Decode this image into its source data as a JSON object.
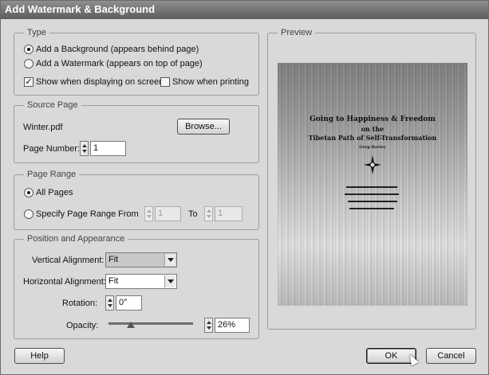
{
  "window": {
    "title": "Add Watermark & Background"
  },
  "type_group": {
    "legend": "Type",
    "option_background": "Add a Background (appears behind page)",
    "option_watermark": "Add a Watermark (appears on top of page)",
    "show_on_screen": "Show when displaying on screen",
    "show_when_printing": "Show when printing",
    "selected": "background",
    "show_on_screen_checked": true,
    "show_when_printing_checked": false
  },
  "source_group": {
    "legend": "Source Page",
    "file_name": "Winter.pdf",
    "browse_label": "Browse...",
    "page_number_label": "Page Number:",
    "page_number_value": "1"
  },
  "range_group": {
    "legend": "Page Range",
    "all_pages_label": "All Pages",
    "specify_label": "Specify Page Range",
    "from_label": "From",
    "from_value": "1",
    "to_label": "To",
    "to_value": "1",
    "selected": "all"
  },
  "position_group": {
    "legend": "Position and Appearance",
    "vertical_label": "Vertical Alignment:",
    "vertical_value": "Fit",
    "horizontal_label": "Horizontal Alignment:",
    "horizontal_value": "Fit",
    "rotation_label": "Rotation:",
    "rotation_value": "0°",
    "opacity_label": "Opacity:",
    "opacity_value": "26%",
    "opacity_fraction": 0.26
  },
  "preview": {
    "legend": "Preview",
    "book_title_line1": "Going to Happiness & Freedom",
    "book_title_line2": "on the",
    "book_title_line3": "Tibetan Path of Self-Transformation",
    "author": "Greg Barley"
  },
  "buttons": {
    "help": "Help",
    "ok": "OK",
    "cancel": "Cancel"
  }
}
